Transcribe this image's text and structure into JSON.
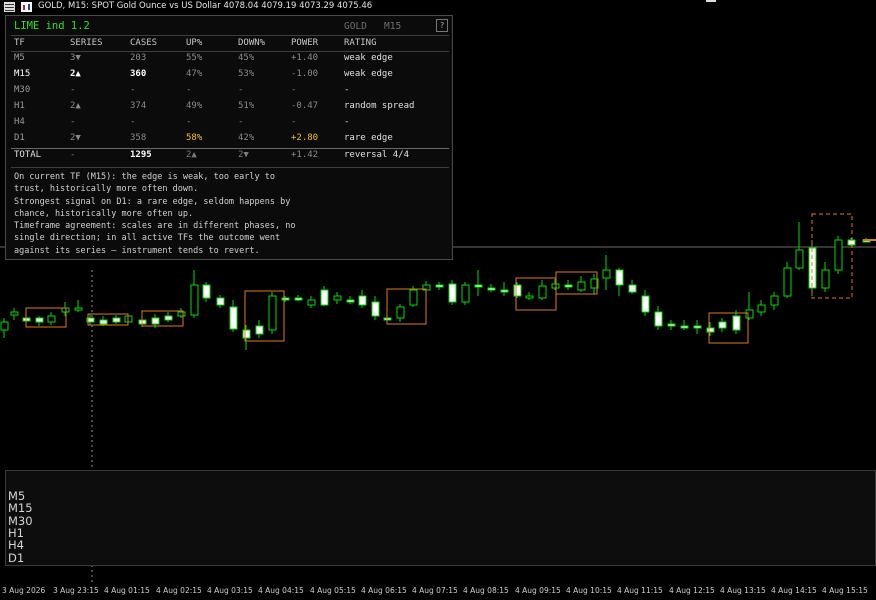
{
  "window": {
    "title": "GOLD, M15:  SPOT Gold Ounce vs US Dollar  4078.04 4079.19 4073.29 4075.46"
  },
  "panel": {
    "title": "LIME ind 1.2",
    "symbol": "GOLD   M15",
    "help_label": "?",
    "headers": [
      "TF",
      "SERIES",
      "CASES",
      "UP%",
      "DOWN%",
      "POWER",
      "RATING"
    ],
    "rows": [
      {
        "tf": "M5",
        "series": "3▼",
        "cases": "203",
        "up": "55%",
        "down": "45%",
        "power": "+1.40",
        "rating": "weak edge"
      },
      {
        "tf": "M15",
        "series": "2▲",
        "cases": "360",
        "up": "47%",
        "down": "53%",
        "power": "-1.00",
        "rating": "weak edge"
      },
      {
        "tf": "M30",
        "series": "-",
        "cases": "-",
        "up": "-",
        "down": "-",
        "power": "-",
        "rating": "-"
      },
      {
        "tf": "H1",
        "series": "2▲",
        "cases": "374",
        "up": "49%",
        "down": "51%",
        "power": "-0.47",
        "rating": "random spread"
      },
      {
        "tf": "H4",
        "series": "-",
        "cases": "-",
        "up": "-",
        "down": "-",
        "power": "-",
        "rating": "-"
      },
      {
        "tf": "D1",
        "series": "2▼",
        "cases": "358",
        "up": "58%",
        "down": "42%",
        "power": "+2.80",
        "rating": "rare edge"
      }
    ],
    "total": {
      "tf": "TOTAL",
      "series": "-",
      "cases": "1295",
      "up": "2▲",
      "down": "2▼",
      "power": "+1.42",
      "rating": "reversal 4/4"
    },
    "note": "On current TF (M15): the edge is weak, too early to\ntrust, historically more often down.\nStrongest signal on D1: a rare edge, seldom happens by\nchance, historically more often up.\nTimeframe agreement: scales are in different phases, no\nsingle direction; in all active TFs the outcome went\nagainst its series — instrument tends to revert.",
    "colors": {
      "title": "#28e228",
      "highlight": "#f0c419",
      "muted": "#8a8a8a",
      "bright": "#ffffff"
    }
  },
  "timeframe_labels": [
    "M5",
    "M15",
    "M30",
    "H1",
    "H4",
    "D1"
  ],
  "time_axis": [
    "3 Aug 2026",
    "3 Aug 23:15",
    "4 Aug 01:15",
    "4 Aug 02:15",
    "4 Aug 03:15",
    "4 Aug 04:15",
    "4 Aug 05:15",
    "4 Aug 06:15",
    "4 Aug 07:15",
    "4 Aug 08:15",
    "4 Aug 09:15",
    "4 Aug 10:15",
    "4 Aug 11:15",
    "4 Aug 12:15",
    "4 Aug 13:15",
    "4 Aug 14:15",
    "4 Aug 15:15"
  ],
  "colors": {
    "bull": "#00dd00",
    "bear": "#ffffff",
    "box": "#e07b1a",
    "up_cell": "#1f5e1f",
    "down_cell": "#7a3838",
    "d1_bar": "#00ff00",
    "cursor": "#e8d800"
  }
}
